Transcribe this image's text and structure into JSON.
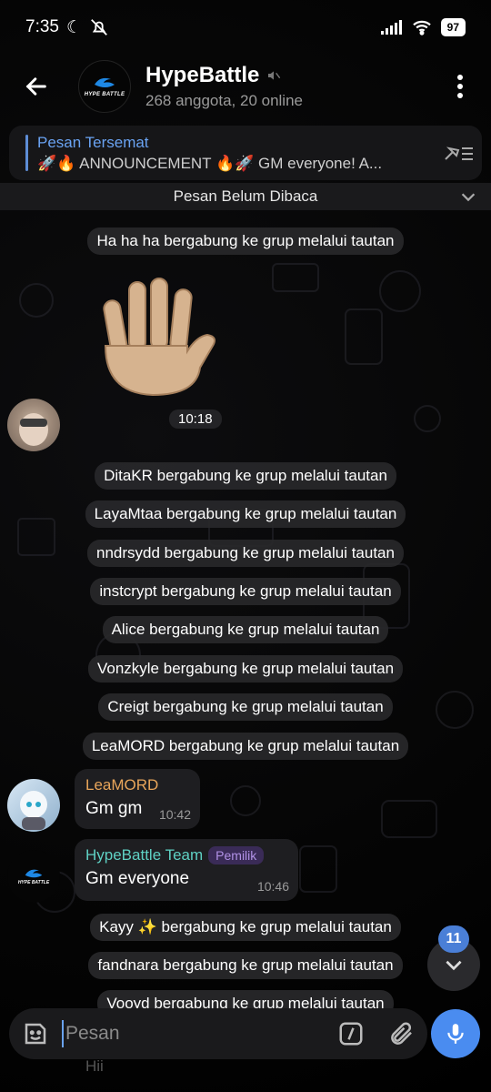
{
  "status_bar": {
    "time": "7:35",
    "battery": "97"
  },
  "header": {
    "title": "HypeBattle",
    "subtitle": "268 anggota, 20 online",
    "avatar_logo_text": "HYPE BATTLE"
  },
  "pinned": {
    "title": "Pesan Tersemat",
    "text": "🚀🔥 ANNOUNCEMENT 🔥🚀 GM everyone! A..."
  },
  "unread_divider": "Pesan Belum Dibaca",
  "messages": {
    "service_0": "Ha ha ha bergabung ke grup melalui tautan",
    "sticker_time": "10:18",
    "service_1": "DitaKR bergabung ke grup melalui tautan",
    "service_2": "LayaMtaa bergabung ke grup melalui tautan",
    "service_3": "nndrsydd bergabung ke grup melalui tautan",
    "service_4": "instcrypt bergabung ke grup melalui tautan",
    "service_5": "Alice bergabung ke grup melalui tautan",
    "service_6": "Vonzkyle bergabung ke grup melalui tautan",
    "service_7": "Creigt bergabung ke grup melalui tautan",
    "service_8": "LeaMORD bergabung ke grup melalui tautan",
    "msg_leamord": {
      "sender": "LeaMORD",
      "text": "Gm gm",
      "time": "10:42",
      "color": "#e8a55a"
    },
    "msg_team": {
      "sender": "HypeBattle Team",
      "badge": "Pemilik",
      "text": "Gm everyone",
      "time": "10:46",
      "color": "#5fd1c4",
      "avatar_logo_text": "HYPE BATTLE"
    },
    "service_9": "Kayy ✨ bergabung ke grup melalui tautan",
    "service_10": "fandnara bergabung ke grup melalui tautan",
    "service_11": "Vooyd bergabung ke grup melalui tautan"
  },
  "scroll_badge": "11",
  "input": {
    "placeholder": "Pesan"
  },
  "hint_text": "Hii",
  "colors": {
    "accent": "#4a8cf0",
    "link": "#6aa3f2"
  }
}
